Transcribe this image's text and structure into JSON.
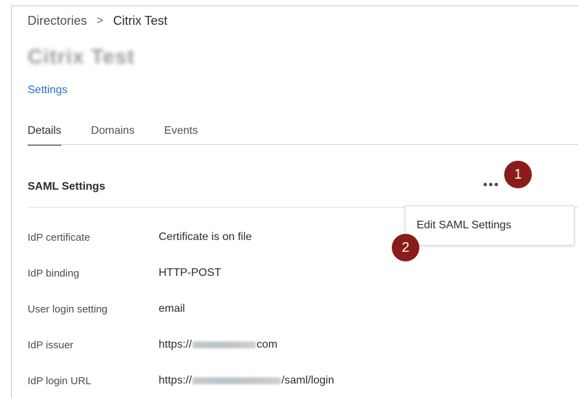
{
  "breadcrumb": {
    "root": "Directories",
    "separator": ">",
    "current": "Citrix Test"
  },
  "page": {
    "title": "Citrix Test",
    "settings_link": "Settings"
  },
  "tabs": [
    {
      "label": "Details",
      "active": true
    },
    {
      "label": "Domains",
      "active": false
    },
    {
      "label": "Events",
      "active": false
    }
  ],
  "section": {
    "title": "SAML Settings",
    "more_icon": "more-horizontal-icon"
  },
  "menu": {
    "items": [
      {
        "label": "Edit SAML Settings"
      }
    ]
  },
  "callouts": {
    "first": "1",
    "second": "2"
  },
  "rows": [
    {
      "label": "IdP certificate",
      "value": "Certificate is on file"
    },
    {
      "label": "IdP binding",
      "value": "HTTP-POST"
    },
    {
      "label": "User login setting",
      "value": "email"
    },
    {
      "label": "IdP issuer",
      "value_prefix": "https://",
      "value_suffix": "com"
    },
    {
      "label": "IdP login URL",
      "value_prefix": "https://",
      "value_suffix": "/saml/login"
    }
  ],
  "colors": {
    "link": "#1f6fd0",
    "callout": "#8b1a1a"
  }
}
